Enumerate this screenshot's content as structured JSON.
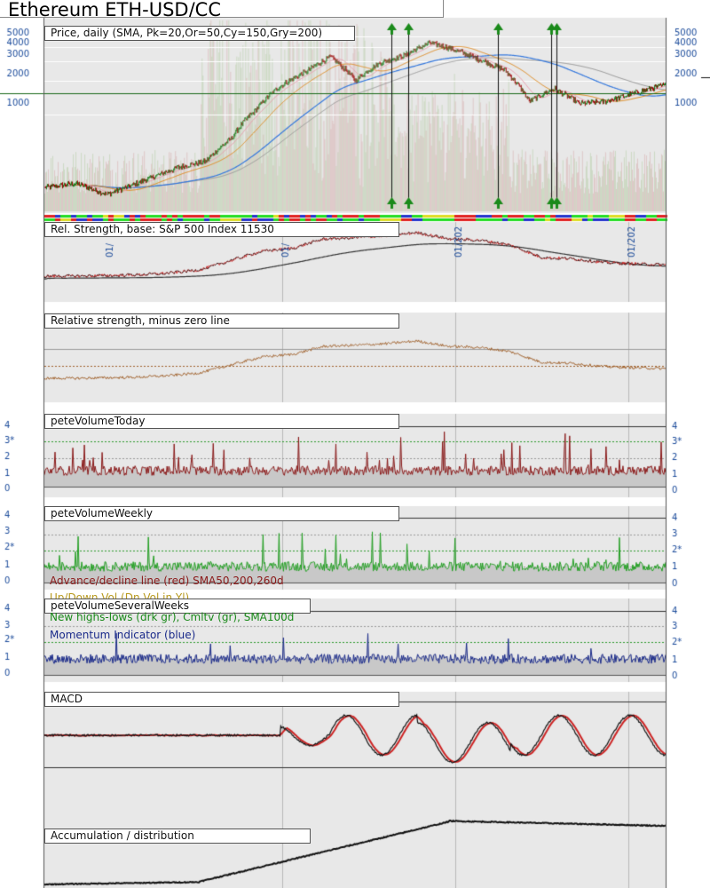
{
  "title": "Ethereum ETH-USD/CC",
  "panels": {
    "price": "Price, daily (SMA, Pk=20,Or=50,Cy=150,Gry=200)",
    "rs": "Rel. Strength, base: S&P 500 Index 11530",
    "rs_minus": "Relative strength, minus zero line",
    "vol_today": "peteVolumeToday",
    "vol_weekly": "peteVolumeWeekly",
    "adv_decline": "Advance/decline line (red) SMA50,200,260d",
    "up_down": "Up/Down Vol (Dn Vol in Yl)",
    "vol_several": "peteVolumeSeveralWeeks",
    "new_highs": "New highs-lows (drk gr), Cmltv (gr), SMA100d",
    "momentum": "Momentum Indicator (blue)",
    "macd": "MACD",
    "acc_dist": "Accumulation / distribution"
  },
  "price_axis": {
    "ticks": [
      "5000",
      "4000",
      "3000",
      "2000",
      "1000"
    ]
  },
  "volume_axis": {
    "ticks": [
      "4",
      "3*",
      "2",
      "1",
      "0"
    ]
  },
  "weekly_axis": {
    "ticks": [
      "4",
      "3",
      "2*",
      "1",
      "0"
    ]
  },
  "date_labels": [
    "01/",
    "01/",
    "01/202",
    "01/202"
  ],
  "colors": {
    "price_up": "#1a7a1a",
    "price_down": "#9b0000",
    "sma_pink": "#e8a0b0",
    "sma_orange": "#e08a20",
    "sma_blue": "#3377dd",
    "sma_gray": "#999999",
    "support_line": "#1a6a1a",
    "signal_arrow": "#1a8a1a",
    "rs_line": "#222222",
    "rs_red": "#cc2222",
    "rs_minus": "#a0602a",
    "vol_today": "#8b1a1a",
    "vol_weekly": "#22a022",
    "momentum": "#1a2a8a",
    "macd_black": "#111111",
    "macd_red": "#cc2222",
    "acc_dist": "#111111",
    "axis_blue": "#1a4a9a",
    "grid_green": "#2a9a2a",
    "panel_bg": "#e8e8e8"
  },
  "chart_data": [
    {
      "type": "line",
      "title": "Price, daily (SMA, Pk=20,Or=50,Cy=150,Gry=200)",
      "scale": "log",
      "ylim": [
        150,
        6500
      ],
      "x": [
        0,
        0.05,
        0.1,
        0.14,
        0.18,
        0.22,
        0.26,
        0.3,
        0.34,
        0.38,
        0.42,
        0.46,
        0.5,
        0.54,
        0.58,
        0.62,
        0.66,
        0.7,
        0.74,
        0.78,
        0.82,
        0.86,
        0.9,
        0.94,
        1.0
      ],
      "series": [
        {
          "values": [
            220,
            240,
            190,
            230,
            280,
            340,
            380,
            600,
            1100,
            1800,
            2400,
            3300,
            2000,
            2900,
            3400,
            4400,
            3800,
            3100,
            2500,
            1300,
            1700,
            1250,
            1300,
            1500,
            1850
          ]
        }
      ]
    }
  ]
}
